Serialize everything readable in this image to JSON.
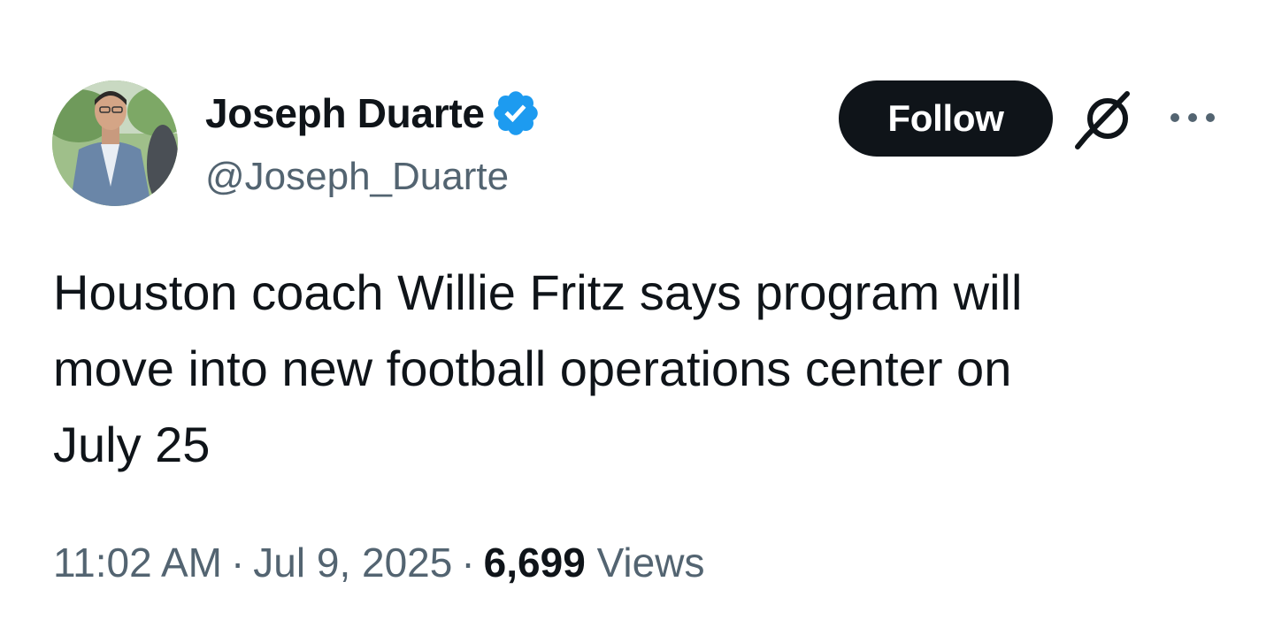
{
  "author": {
    "display_name": "Joseph Duarte",
    "handle": "@Joseph_Duarte",
    "verified": true,
    "verified_color": "#1d9bf0"
  },
  "actions": {
    "follow_label": "Follow",
    "grok_icon": "grok-icon",
    "more_icon": "more-horizontal-icon"
  },
  "tweet": {
    "text_lines": [
      "Houston coach Willie Fritz says program will",
      "move into new football operations center on",
      "July 25"
    ]
  },
  "meta": {
    "time": "11:02 AM",
    "separator": "·",
    "date": "Jul 9, 2025",
    "views_count": "6,699",
    "views_label": "Views"
  },
  "colors": {
    "text_primary": "#0f1419",
    "text_secondary": "#536471",
    "button_bg": "#0f1419",
    "button_text": "#ffffff"
  }
}
